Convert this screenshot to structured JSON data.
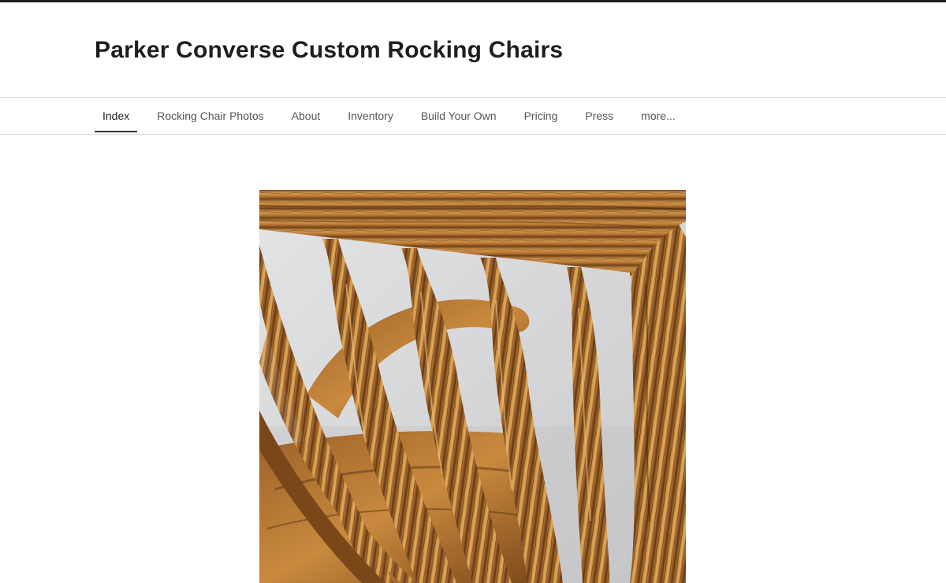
{
  "site": {
    "title": "Parker Converse Custom Rocking Chairs"
  },
  "nav": {
    "items": [
      {
        "label": "Index",
        "active": true
      },
      {
        "label": "Rocking Chair Photos",
        "active": false
      },
      {
        "label": "About",
        "active": false
      },
      {
        "label": "Inventory",
        "active": false
      },
      {
        "label": "Build Your Own",
        "active": false
      },
      {
        "label": "Pricing",
        "active": false
      },
      {
        "label": "Press",
        "active": false
      },
      {
        "label": "more...",
        "active": false
      }
    ]
  },
  "colors": {
    "top_bar": "#1f1f1f",
    "nav_border": "#dcdcdc",
    "active_underline": "#333333",
    "wood_light": "#c98a3e",
    "wood_dark": "#5a3414",
    "wall": "#d9dadc"
  }
}
